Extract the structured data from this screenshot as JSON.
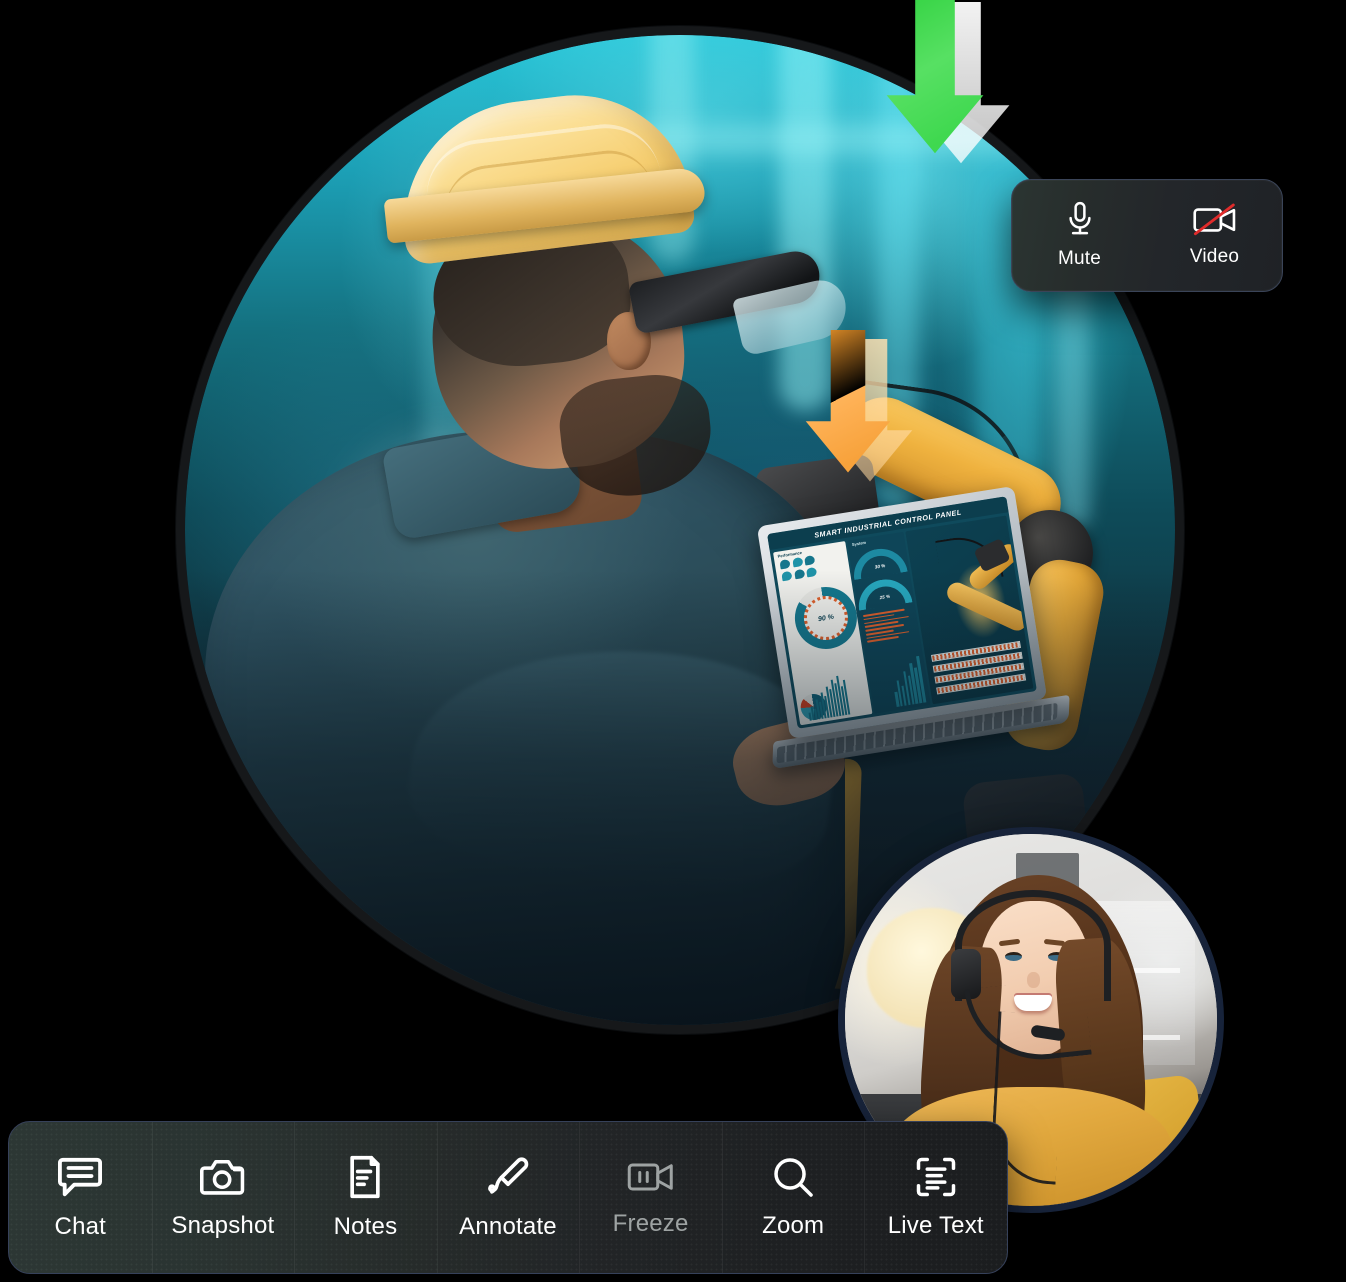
{
  "app": {
    "screen_name": "remote-assistance-video-call"
  },
  "main_video": {
    "label": "field-technician-live-view",
    "description": "Industrial worker wearing yellow hard hat and safety glasses holding a laptop in a factory",
    "laptop_screen": {
      "title": "SMART INDUSTRIAL CONTROL PANEL",
      "panel_left_label": "Performance",
      "panel_mid_label": "System",
      "gauge_value": "90 %",
      "arc_top_value": "30 %",
      "arc_bottom_value": "25 %"
    },
    "annotations": [
      {
        "name": "green-arrow",
        "direction": "down",
        "color": "#3fd84f"
      },
      {
        "name": "orange-arrow",
        "direction": "down",
        "color": "#f7a23b"
      }
    ]
  },
  "pip_video": {
    "label": "remote-expert-self-view",
    "description": "Support agent with headset smiling in an office"
  },
  "top_controls": {
    "items": [
      {
        "label": "Mute",
        "icon": "microphone-icon",
        "state": "on"
      },
      {
        "label": "Video",
        "icon": "video-off-icon",
        "state": "off",
        "slash_color": "#e02b2b"
      }
    ]
  },
  "toolbar": {
    "items": [
      {
        "label": "Chat",
        "icon": "chat-bubble-icon",
        "disabled": false
      },
      {
        "label": "Snapshot",
        "icon": "camera-icon",
        "disabled": false
      },
      {
        "label": "Notes",
        "icon": "document-icon",
        "disabled": false
      },
      {
        "label": "Annotate",
        "icon": "pen-icon",
        "disabled": false
      },
      {
        "label": "Freeze",
        "icon": "video-pause-icon",
        "disabled": true
      },
      {
        "label": "Zoom",
        "icon": "magnifier-icon",
        "disabled": false
      },
      {
        "label": "Live Text",
        "icon": "scan-text-icon",
        "disabled": false
      }
    ]
  },
  "colors": {
    "panel_bg": "#242a2b",
    "toolbar_bg": "#262b2a",
    "border": "#36415a",
    "text": "#ffffff",
    "disabled_text": "#9ea3a3",
    "accent_teal": "#1c9fb5",
    "accent_yellow": "#efb23f"
  }
}
